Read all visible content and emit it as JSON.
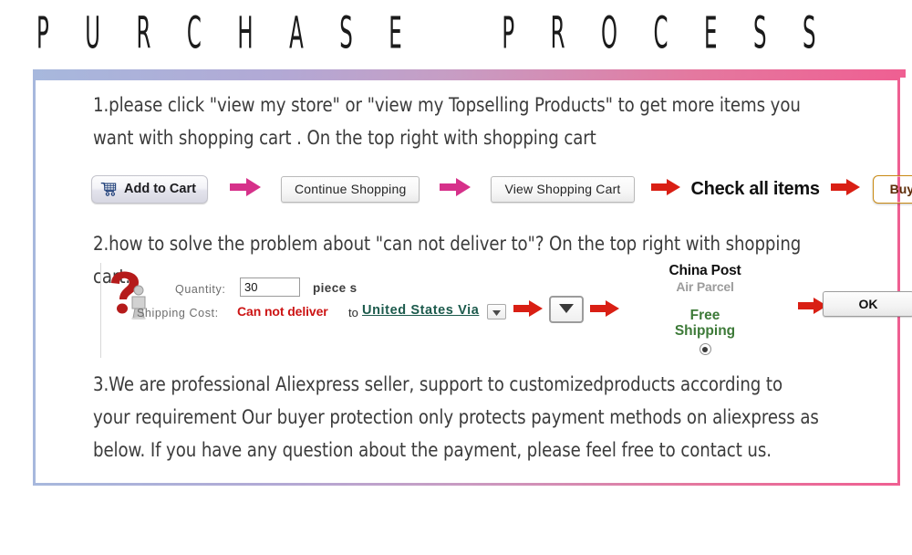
{
  "banner": {
    "title": "P U R C H A S E    P R O C E S S",
    "gradient_start": "#a7b8dd",
    "gradient_end": "#ef5f92"
  },
  "content": {
    "paragraph1": "1.please click \"view my store\" or \"view my Topselling Products\" to get more items you want with shopping cart . On the top right with shopping cart",
    "paragraph2": "2.how to solve the problem about \"can not deliver to\"?  On the top right with shopping cart.",
    "paragraph3": "3.We are professional Aliexpress seller, support to customizedproducts according to your requirement   Our buyer protection only protects payment methods on aliexpress as below. If you have any question   about the payment, please feel free to contact us."
  },
  "step_flow_1": {
    "add_to_cart_label": "Add to Cart",
    "cart_icon": "shopping-cart-icon",
    "continue_shopping_label": "Continue Shopping",
    "view_cart_label": "View Shopping Cart",
    "check_all_items_label": "Check all items",
    "buy_now_label": "Buy Now",
    "arrow_color_pink": "#d6318a",
    "arrow_color_red": "#d91f14",
    "buy_now_color": "#f6a723"
  },
  "step_flow_2": {
    "help_icon": "question-mark-icon",
    "quantity_label": "Quantity:",
    "quantity_value": "30",
    "piece_label": "piece s",
    "shipping_cost_label": "Shipping Cost:",
    "cannot_deliver_text": "Can not deliver",
    "to_text": "to",
    "destination_link": "United States Via",
    "dropdown_icon": "chevron-down-icon",
    "carrier_line1": "China Post",
    "carrier_line2": "Air Parcel",
    "free_shipping_line1": "Free",
    "free_shipping_line2": "Shipping",
    "radio_state": "selected",
    "ok_label": "OK",
    "cannot_deliver_color": "#cc1414",
    "link_color": "#1c5a4c",
    "free_shipping_color": "#3d7a38"
  }
}
